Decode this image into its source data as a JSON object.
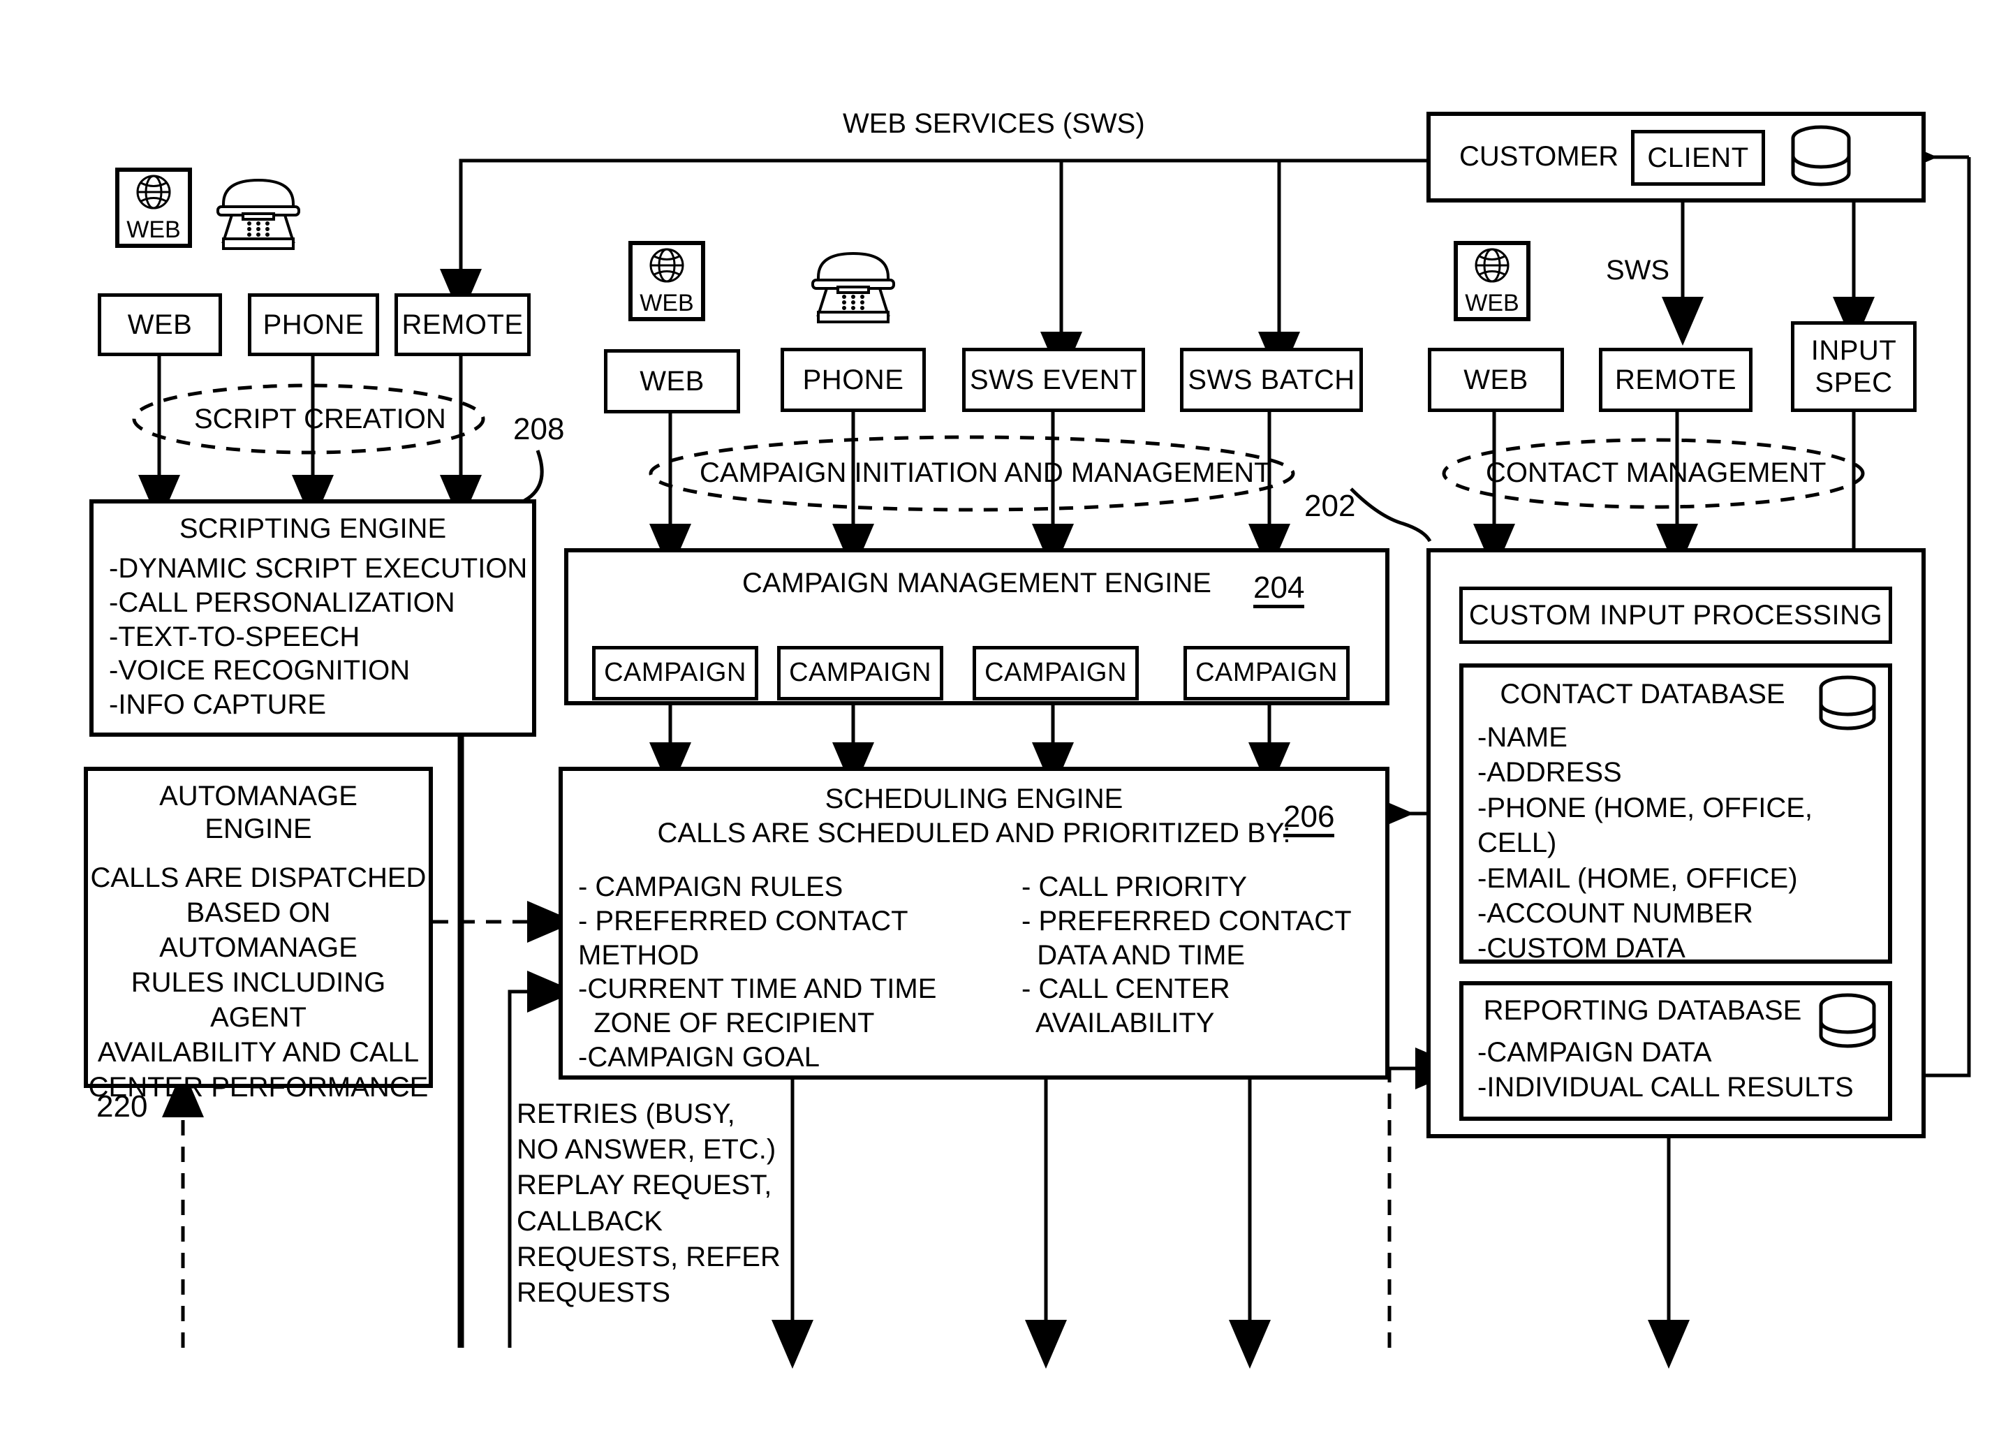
{
  "diagram": {
    "header_label": "WEB SERVICES (SWS)",
    "sws_label": "SWS"
  },
  "reference_numbers": {
    "scripting": "208",
    "campaign_engine": "204",
    "scheduling_engine": "206",
    "contact_management": "202",
    "automanage": "220"
  },
  "ellipses": {
    "script_creation": "SCRIPT CREATION",
    "campaign_initiation": "CAMPAIGN INITIATION AND MANAGEMENT",
    "contact_management": "CONTACT MANAGEMENT"
  },
  "left_group": {
    "icons": [
      {
        "type": "web-globe-icon",
        "label": "WEB"
      },
      {
        "type": "telephone-icon",
        "label": ""
      }
    ],
    "channel_boxes": [
      {
        "label": "WEB"
      },
      {
        "label": "PHONE"
      },
      {
        "label": "REMOTE"
      }
    ]
  },
  "middle_group": {
    "icons": [
      {
        "type": "web-globe-icon",
        "label": "WEB"
      },
      {
        "type": "telephone-icon",
        "label": ""
      }
    ],
    "channel_boxes": [
      {
        "label": "WEB"
      },
      {
        "label": "PHONE"
      },
      {
        "label": "SWS EVENT"
      },
      {
        "label": "SWS BATCH"
      }
    ]
  },
  "right_group": {
    "icons": [
      {
        "type": "web-globe-icon",
        "label": "WEB"
      }
    ],
    "channel_boxes": [
      {
        "label": "WEB"
      },
      {
        "label": "REMOTE"
      }
    ],
    "input_spec": "INPUT\nSPEC"
  },
  "customer_panel": {
    "customer_label": "CUSTOMER",
    "client_label": "CLIENT",
    "database_icon": "database-cylinder-icon"
  },
  "scripting_engine": {
    "title": "SCRIPTING ENGINE",
    "items": [
      "-DYNAMIC SCRIPT EXECUTION",
      "-CALL PERSONALIZATION",
      "-TEXT-TO-SPEECH",
      "-VOICE RECOGNITION",
      "-INFO CAPTURE"
    ]
  },
  "automanage_engine": {
    "title_line1": "AUTOMANAGE",
    "title_line2": "ENGINE",
    "body": "CALLS ARE DISPATCHED\nBASED ON AUTOMANAGE\nRULES INCLUDING AGENT\nAVAILABILITY AND CALL\nCENTER PERFORMANCE"
  },
  "campaign_management_engine": {
    "title": "CAMPAIGN MANAGEMENT ENGINE",
    "campaigns": [
      "CAMPAIGN",
      "CAMPAIGN",
      "CAMPAIGN",
      "CAMPAIGN"
    ]
  },
  "scheduling_engine": {
    "title": "SCHEDULING ENGINE",
    "subtitle": "CALLS ARE SCHEDULED AND PRIORITIZED BY:",
    "left_items": [
      "- CAMPAIGN RULES",
      "- PREFERRED CONTACT METHOD",
      "-CURRENT TIME AND TIME",
      "  ZONE OF RECIPIENT",
      "-CAMPAIGN GOAL"
    ],
    "right_items": [
      "- CALL PRIORITY",
      "- PREFERRED CONTACT",
      "  DATA AND TIME",
      "- CALL CENTER",
      "  AVAILABILITY"
    ]
  },
  "retries_note": "RETRIES (BUSY,\nNO ANSWER, ETC.)\nREPLAY REQUEST,\nCALLBACK\nREQUESTS, REFER\nREQUESTS",
  "custom_input_processing": {
    "label": "CUSTOM INPUT PROCESSING"
  },
  "contact_database": {
    "title": "CONTACT DATABASE",
    "icon": "database-cylinder-icon",
    "items": [
      "-NAME",
      "-ADDRESS",
      "-PHONE (HOME, OFFICE, CELL)",
      "-EMAIL (HOME, OFFICE)",
      "-ACCOUNT NUMBER",
      "-CUSTOM DATA"
    ]
  },
  "reporting_database": {
    "title": "REPORTING DATABASE",
    "icon": "database-cylinder-icon",
    "items": [
      "-CAMPAIGN DATA",
      "-INDIVIDUAL CALL RESULTS"
    ]
  },
  "colors": {
    "ink": "#000000",
    "paper": "#ffffff"
  }
}
